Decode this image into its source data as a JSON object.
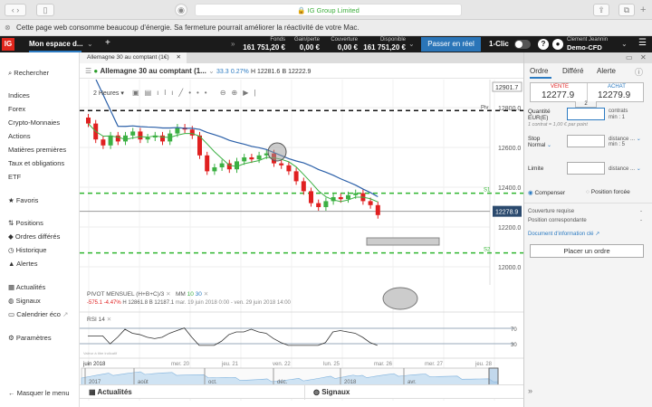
{
  "browser": {
    "url_label": "IG Group Limited"
  },
  "notice": {
    "text": "Cette page web consomme beaucoup d'énergie. Sa fermeture pourrait améliorer la réactivité de votre Mac."
  },
  "topbar": {
    "logo": "IG",
    "workspace": "Mon espace d...",
    "fonds_label": "Fonds",
    "fonds": "161 751,20 €",
    "gain_label": "Gain/perte",
    "gain": "0,00 €",
    "couverture_label": "Couverture",
    "couverture": "0,00 €",
    "dispo_label": "Disponible",
    "dispo": "161 751,20 €",
    "live_button": "Passer en réel",
    "oneclick": "1-Clic",
    "user_name": "Clement Jeannin",
    "account": "Demo-CFD"
  },
  "sidebar": {
    "search": "Rechercher",
    "markets": [
      "Indices",
      "Forex",
      "Crypto-Monnaies",
      "Actions",
      "Matières premières",
      "Taux et obligations",
      "ETF"
    ],
    "favoris": "Favoris",
    "trading": [
      "Positions",
      "Ordres différés",
      "Historique",
      "Alertes"
    ],
    "info": [
      "Actualités",
      "Signaux",
      "Calendrier éco"
    ],
    "settings": "Paramètres",
    "hide": "Masquer le menu"
  },
  "chart": {
    "tab": "Allemagne 30 au comptant (1€)",
    "instrument": "Allemagne 30 au comptant (1...",
    "change": "33.3",
    "change_pct": "0.27%",
    "high": "H 12281.6",
    "low": "B 12222.9",
    "timeframe": "2 Heures",
    "indicators_label": "PIVOT",
    "pivot_period": "MENSUEL",
    "pivot_formula": "(H+B+C)/3",
    "mm_label": "MM",
    "mm_fast": "10",
    "mm_slow": "30",
    "period_change": "-575.1",
    "period_change_pct": "-4.47%",
    "period_high": "H 12861.8",
    "period_low": "B 12187.1",
    "period_range": "mar. 19 juin 2018 0:00 - ven. 29 juin 2018 14:00",
    "rsi_label": "RSI",
    "rsi_period": "14",
    "disclaimer": "Valeur à titre indicatif",
    "bottom_tabs": [
      "Actualités",
      "Signaux"
    ],
    "colors": {
      "up": "#3cb043",
      "down": "#e02020",
      "ma_fast": "#3cb043",
      "ma_slow": "#2a5fa8",
      "pivot": "#111111",
      "support": "#2fb52f"
    }
  },
  "chart_data": {
    "type": "candlestick",
    "y_ticks": [
      "12800.0",
      "12600.0",
      "12400.0",
      "12200.0",
      "12000.0"
    ],
    "ylim": [
      11990,
      12910
    ],
    "y_top_label": "12901.7",
    "current_price": 12278.9,
    "current_label": "12278.9",
    "levels": [
      {
        "name": "Piv",
        "value": 12785
      },
      {
        "name": "S1",
        "value": 12370
      },
      {
        "name": "S2",
        "value": 12070
      }
    ],
    "x_ticks": [
      "juin 2018",
      "mer. 20",
      "jeu. 21",
      "ven. 22",
      "lun. 25",
      "mar. 26",
      "mer. 27",
      "jeu. 28",
      "ven. 29"
    ],
    "closes": [
      12720,
      12640,
      12610,
      12660,
      12630,
      12660,
      12680,
      12640,
      12650,
      12660,
      12630,
      12670,
      12700,
      12690,
      12660,
      12560,
      12480,
      12500,
      12520,
      12490,
      12530,
      12550,
      12540,
      12560,
      12570,
      12520,
      12510,
      12480,
      12430,
      12380,
      12320,
      12300,
      12330,
      12350,
      12340,
      12360,
      12370,
      12330,
      12310,
      12260
    ],
    "rsi_ticks": [
      "70",
      "30"
    ],
    "navigator_labels": [
      "2017",
      "août",
      "oct.",
      "déc.",
      "2018",
      "avr."
    ]
  },
  "order": {
    "tabs": [
      "Ordre",
      "Différé",
      "Alerte"
    ],
    "sell_label": "VENTE",
    "sell": "12277.9",
    "buy_label": "ACHAT",
    "buy": "12279.9",
    "spread": "2",
    "qty_label": "Quantité",
    "qty_unit": "EUR(E)",
    "qty_suffix": "contrats",
    "qty_min": "min : 1",
    "contract_note": "1 contrat = 1,00 € par point",
    "stop_label": "Stop",
    "stop_type": "Normal",
    "distance": "distance ...",
    "stop_min": "min : 5",
    "limit_label": "Limite",
    "compenser": "Compenser",
    "forcee": "Position forcée",
    "couv_req": "Couverture requise",
    "pos_corr": "Position correspondante",
    "dash": "-",
    "doc_link": "Document d'information clé",
    "place": "Placer un ordre"
  }
}
